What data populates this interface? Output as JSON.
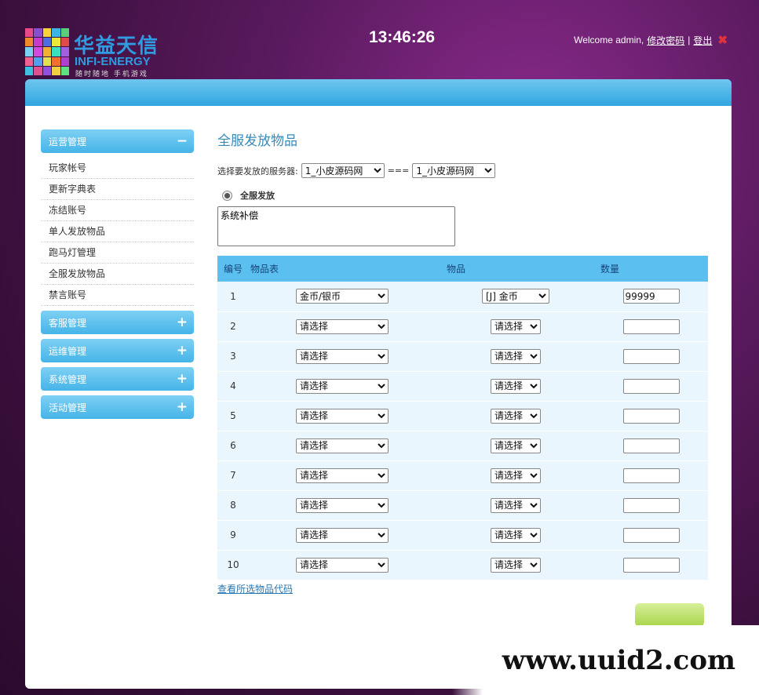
{
  "header": {
    "logo_cn": "华益天信",
    "logo_en": "INFI-ENERGY",
    "logo_sub": "随时随地 手机游戏",
    "clock": "13:46:26",
    "welcome": "Welcome admin,",
    "change_password": "修改密码",
    "separator": "|",
    "logout": "登出"
  },
  "sidebar": {
    "groups": [
      {
        "label": "运营管理",
        "sign": "−",
        "expanded": true
      },
      {
        "label": "客服管理",
        "sign": "+"
      },
      {
        "label": "运维管理",
        "sign": "+"
      },
      {
        "label": "系统管理",
        "sign": "+"
      },
      {
        "label": "活动管理",
        "sign": "+"
      }
    ],
    "items": [
      "玩家帐号",
      "更新字典表",
      "冻结账号",
      "单人发放物品",
      "跑马灯管理",
      "全服发放物品",
      "禁言账号"
    ]
  },
  "main": {
    "title": "全服发放物品",
    "server_label": "选择要发放的服务器:",
    "server_from": "1_小皮源码网",
    "server_sep": "===",
    "server_to": "1_小皮源码网",
    "radio_label": "全服发放",
    "message": "系统补偿",
    "table": {
      "headers": [
        "编号",
        "物品表",
        "物品",
        "数量"
      ],
      "rows": [
        {
          "no": "1",
          "table": "金币/银币",
          "item": "[J] 金币",
          "qty": "99999"
        },
        {
          "no": "2",
          "table": "请选择",
          "item": "请选择",
          "qty": ""
        },
        {
          "no": "3",
          "table": "请选择",
          "item": "请选择",
          "qty": ""
        },
        {
          "no": "4",
          "table": "请选择",
          "item": "请选择",
          "qty": ""
        },
        {
          "no": "5",
          "table": "请选择",
          "item": "请选择",
          "qty": ""
        },
        {
          "no": "6",
          "table": "请选择",
          "item": "请选择",
          "qty": ""
        },
        {
          "no": "7",
          "table": "请选择",
          "item": "请选择",
          "qty": ""
        },
        {
          "no": "8",
          "table": "请选择",
          "item": "请选择",
          "qty": ""
        },
        {
          "no": "9",
          "table": "请选择",
          "item": "请选择",
          "qty": ""
        },
        {
          "no": "10",
          "table": "请选择",
          "item": "请选择",
          "qty": ""
        }
      ]
    },
    "view_codes": "查看所选物品代码"
  },
  "watermark": "www.uuid2.com",
  "colors": {
    "accent": "#45b4e8",
    "header_row": "#5bc0ef",
    "row_bg": "#eaf6fd",
    "submit": "#a9d54a",
    "background": "#5a1a5e"
  }
}
